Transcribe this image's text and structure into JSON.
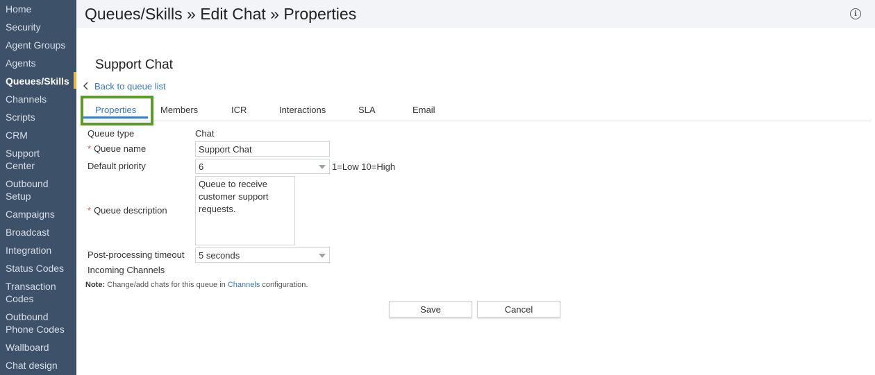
{
  "sidebar": {
    "items": [
      {
        "label": "Home"
      },
      {
        "label": "Security"
      },
      {
        "label": "Agent Groups"
      },
      {
        "label": "Agents"
      },
      {
        "label": "Queues/Skills",
        "active": true
      },
      {
        "label": "Channels"
      },
      {
        "label": "Scripts"
      },
      {
        "label": "CRM"
      },
      {
        "label": "Support",
        "label2": "Center"
      },
      {
        "label": "Outbound",
        "label2": "Setup"
      },
      {
        "label": "Campaigns"
      },
      {
        "label": "Broadcast"
      },
      {
        "label": "Integration"
      },
      {
        "label": "Status Codes"
      },
      {
        "label": "Transaction",
        "label2": "Codes"
      },
      {
        "label": "Outbound",
        "label2": "Phone Codes"
      },
      {
        "label": "Wallboard"
      },
      {
        "label": "Chat design"
      }
    ],
    "accent_color": "#f1b43f",
    "background": "#3d5169"
  },
  "header": {
    "title": "Queues/Skills » Edit Chat » Properties",
    "info_icon": "info-icon"
  },
  "main": {
    "queue_title": "Support Chat",
    "back_link": "Back to queue list",
    "tabs": [
      {
        "label": "Properties",
        "active": true
      },
      {
        "label": "Members"
      },
      {
        "label": "ICR"
      },
      {
        "label": "Interactions"
      },
      {
        "label": "SLA"
      },
      {
        "label": "Email"
      }
    ],
    "form": {
      "queue_type_label": "Queue type",
      "queue_type_value": "Chat",
      "required_mark": "*",
      "queue_name_label": "Queue name",
      "queue_name_value": "Support Chat",
      "default_priority_label": "Default priority",
      "default_priority_value": "6",
      "priority_hint": "1=Low 10=High",
      "queue_description_label": "Queue description",
      "queue_description_lines": [
        "Queue to receive",
        "customer support",
        "requests."
      ],
      "post_processing_label": "Post-processing timeout",
      "post_processing_value": "5 seconds",
      "incoming_channels_label": "Incoming Channels"
    },
    "note": {
      "prefix": "Note:",
      "text_before": " Change/add chats for this queue in ",
      "link": "Channels",
      "text_after": " configuration."
    },
    "buttons": {
      "save": "Save",
      "cancel": "Cancel"
    },
    "colors": {
      "link": "#3577c1",
      "tab_highlight_border": "#5c9b29",
      "tab_underline": "#2c7fd8",
      "required": "#d9534f"
    }
  }
}
